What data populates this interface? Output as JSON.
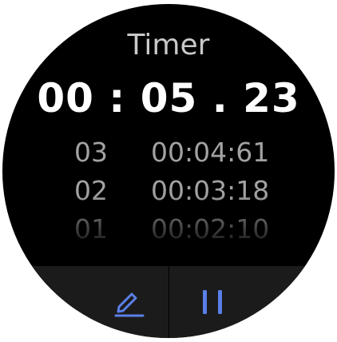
{
  "title": "Timer",
  "main_time": "00 : 05 . 23",
  "laps": [
    {
      "number": "03",
      "time": "00:04:61"
    },
    {
      "number": "02",
      "time": "00:03:18"
    },
    {
      "number": "01",
      "time": "00:02:10"
    }
  ],
  "icons": {
    "edit": "edit-pencil-icon",
    "pause": "pause-icon"
  },
  "colors": {
    "background": "#000000",
    "title": "#c9c9c9",
    "main_time": "#ffffff",
    "lap_text": "#a2a2a2",
    "button_bar": "#1b1b1b",
    "accent": "#5b7fe8"
  }
}
